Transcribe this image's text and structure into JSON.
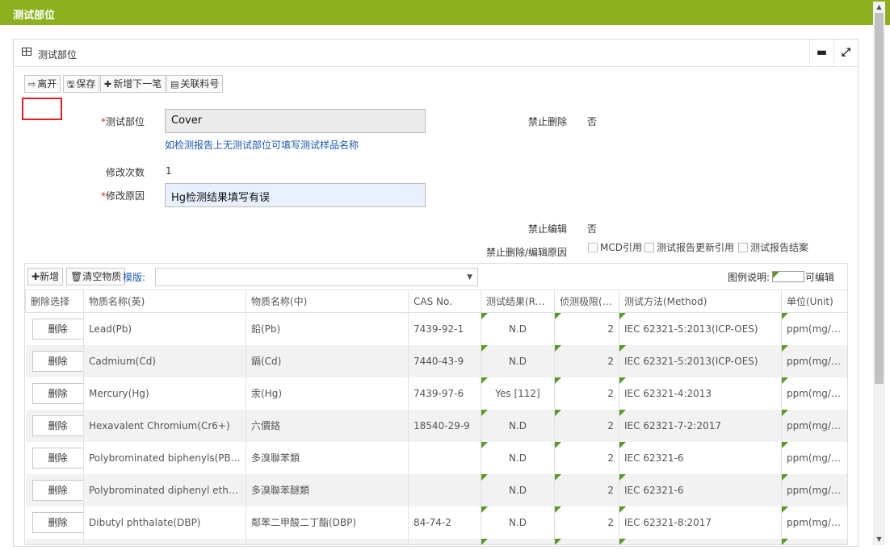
{
  "window": {
    "title": "测试部位"
  },
  "panel": {
    "title": "测试部位",
    "minimize_symbol": "▬",
    "expand_symbol": "⤢"
  },
  "toolbar": {
    "leave_label": "离开",
    "save_label": "保存",
    "add_next_label": "新增下一笔",
    "related_part_label": "关联料号"
  },
  "form": {
    "test_part": {
      "required_mark": "*",
      "label": "测试部位",
      "value": "Cover",
      "hint": "如检测报告上无测试部位可填写测试样品名称"
    },
    "forbid_delete": {
      "label": "禁止删除",
      "value": "否"
    },
    "modify_count": {
      "label": "修改次数",
      "value": "1"
    },
    "modify_reason": {
      "required_mark": "*",
      "label": "修改原因",
      "value": "Hg检测结果填写有误"
    },
    "forbid_edit": {
      "label": "禁止编辑",
      "value": "否"
    },
    "forbid_reason": {
      "label": "禁止删除/编辑原因",
      "options": [
        "MCD引用",
        "测试报告更新引用",
        "测试报告结案"
      ]
    }
  },
  "grid": {
    "add_label": "新增",
    "clear_label": "清空物质",
    "template_label": "模版:",
    "template_value": "",
    "legend_label": "图例说明:",
    "legend_editable": "可编辑",
    "columns": [
      "删除选择",
      "物质名称(英)",
      "物质名称(中)",
      "CAS No.",
      "测试结果(Result)",
      "侦测极限(MDL)",
      "测试方法(Method)",
      "单位(Unit)"
    ],
    "delete_label": "删除",
    "rows": [
      {
        "name_en": "Lead(Pb)",
        "name_cn": "鉛(Pb)",
        "cas": "7439-92-1",
        "result": "N.D",
        "mdl": "2",
        "method": "IEC 62321-5:2013(ICP-OES)",
        "unit": "ppm(mg/kg)"
      },
      {
        "name_en": "Cadmium(Cd)",
        "name_cn": "鎘(Cd)",
        "cas": "7440-43-9",
        "result": "N.D",
        "mdl": "2",
        "method": "IEC 62321-5:2013(ICP-OES)",
        "unit": "ppm(mg/kg)"
      },
      {
        "name_en": "Mercury(Hg)",
        "name_cn": "汞(Hg)",
        "cas": "7439-97-6",
        "result": "Yes [112]",
        "mdl": "2",
        "method": "IEC 62321-4:2013",
        "unit": "ppm(mg/kg)"
      },
      {
        "name_en": "Hexavalent Chromium(Cr6+)",
        "name_cn": "六價鉻",
        "cas": "18540-29-9",
        "result": "N.D",
        "mdl": "2",
        "method": "IEC 62321-7-2:2017",
        "unit": "ppm(mg/kg)"
      },
      {
        "name_en": "Polybrominated biphenyls(PBBs)",
        "name_cn": "多溴聯苯類",
        "cas": "",
        "result": "N.D",
        "mdl": "2",
        "method": "IEC 62321-6",
        "unit": "ppm(mg/kg)"
      },
      {
        "name_en": "Polybrominated diphenyl ethers(PBDEs)",
        "name_cn": "多溴聯苯醚類",
        "cas": "",
        "result": "N.D",
        "mdl": "2",
        "method": "IEC 62321-6",
        "unit": "ppm(mg/kg)"
      },
      {
        "name_en": "Dibutyl phthalate(DBP)",
        "name_cn": "鄰苯二甲酸二丁酯(DBP)",
        "cas": "84-74-2",
        "result": "N.D",
        "mdl": "2",
        "method": "IEC 62321-8:2017",
        "unit": "ppm(mg/kg)"
      },
      {
        "name_en": "",
        "name_cn": "",
        "cas": "",
        "result": "",
        "mdl": "",
        "method": "",
        "unit": ""
      }
    ]
  },
  "colors": {
    "titlebar": "#8cb01e",
    "editable_marker": "#5a9a1e",
    "hint_link": "#1a57b8",
    "highlight": "#e02020"
  }
}
